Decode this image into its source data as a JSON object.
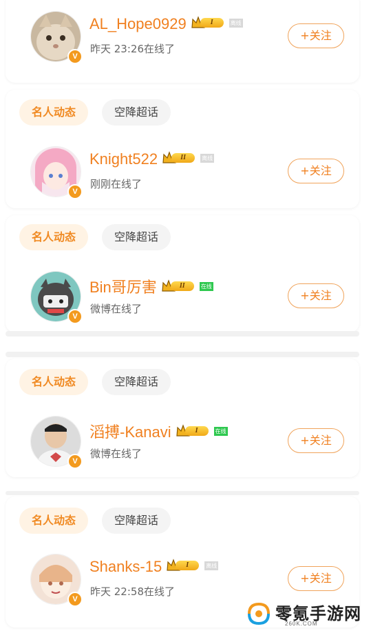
{
  "users": [
    {
      "name": "AL_Hope0929",
      "level": "I",
      "status": "离线",
      "status_type": "off",
      "subtitle": "昨天 23:26在线了",
      "follow": "+关注",
      "verified": "V"
    },
    {
      "name": "Knight522",
      "level": "II",
      "status": "离线",
      "status_type": "off",
      "subtitle": "刚刚在线了",
      "follow": "+关注",
      "verified": "V"
    },
    {
      "name": "Bin哥厉害",
      "level": "II",
      "status": "在线",
      "status_type": "on",
      "subtitle": "微博在线了",
      "follow": "+关注",
      "verified": "V"
    },
    {
      "name": "滔搏-Kanavi",
      "level": "I",
      "status": "在线",
      "status_type": "on",
      "subtitle": "微博在线了",
      "follow": "+关注",
      "verified": "V"
    },
    {
      "name": "Shanks-15",
      "level": "I",
      "status": "离线",
      "status_type": "off",
      "subtitle": "昨天 22:58在线了",
      "follow": "+关注",
      "verified": "V"
    }
  ],
  "tags": {
    "celebrity": "名人动态",
    "topic": "空降超话"
  },
  "watermark": {
    "title": "零氪手游网",
    "url": "260K.COM"
  },
  "colors": {
    "accent": "#f08020",
    "online": "#2ec84f",
    "offline": "#d8d8d8"
  }
}
